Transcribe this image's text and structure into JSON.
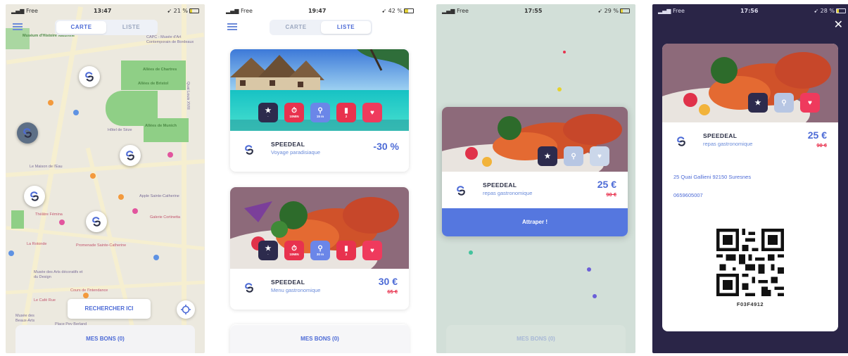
{
  "status_bars": [
    {
      "carrier": "Free",
      "time": "13:47",
      "battery": "21 %"
    },
    {
      "carrier": "Free",
      "time": "19:47",
      "battery": "42 %"
    },
    {
      "carrier": "Free",
      "time": "17:55",
      "battery": "29 %"
    },
    {
      "carrier": "Free",
      "time": "17:56",
      "battery": "28 %"
    }
  ],
  "tabs": {
    "map": "CARTE",
    "list": "LISTE"
  },
  "map": {
    "search_button": "RECHERCHER ICI",
    "labels": [
      "Muséum d'Histoire Naturelle",
      "CAPC - Musée d'Art Contemporain de Bordeaux",
      "Allées de Chartres",
      "Allées de Bristol",
      "Allées de Munich",
      "Hôtel de Sèze",
      "Le Maison de l'Eau",
      "Galerie Cortinetta",
      "Apple Sainte-Catherine",
      "Théâtre Fémina",
      "Promenade Sainte-Catherine",
      "Musée des Arts décoratifs et du Design",
      "Cours de l'Intendance",
      "Le Café Rue",
      "Musée des Beaux-Arts",
      "Place Pey Berland",
      "La Rotonde",
      "Quai Louis XVIII"
    ]
  },
  "bons_button": "MES BONS (0)",
  "offers": [
    {
      "brand": "SPEEDEAL",
      "title": "Voyage paradisiaque",
      "discount": "-30 %",
      "badges": [
        "★",
        "10MIN",
        "15 m",
        "2"
      ]
    },
    {
      "brand": "SPEEDEAL",
      "title": "Menu gastronomique",
      "price": "30 €",
      "old_price": "65 €",
      "badges": [
        "★",
        "10MIN",
        "30 m",
        "2"
      ]
    }
  ],
  "popup": {
    "brand": "SPEEDEAL",
    "title": "repas gastronomique",
    "price": "25 €",
    "old_price": "90 €",
    "catch_button": "Attraper !"
  },
  "coupon": {
    "brand": "SPEEDEAL",
    "title": "repas gastronomique",
    "price": "25 €",
    "old_price": "90 €",
    "address": "25 Quai Gallieni 92150 Suresnes",
    "phone": "0659605007",
    "code": "F03F4912"
  },
  "colors": {
    "accent": "#4d6bd6",
    "red": "#e8324e",
    "navy": "#2a2547",
    "park": "#8fcf86"
  }
}
